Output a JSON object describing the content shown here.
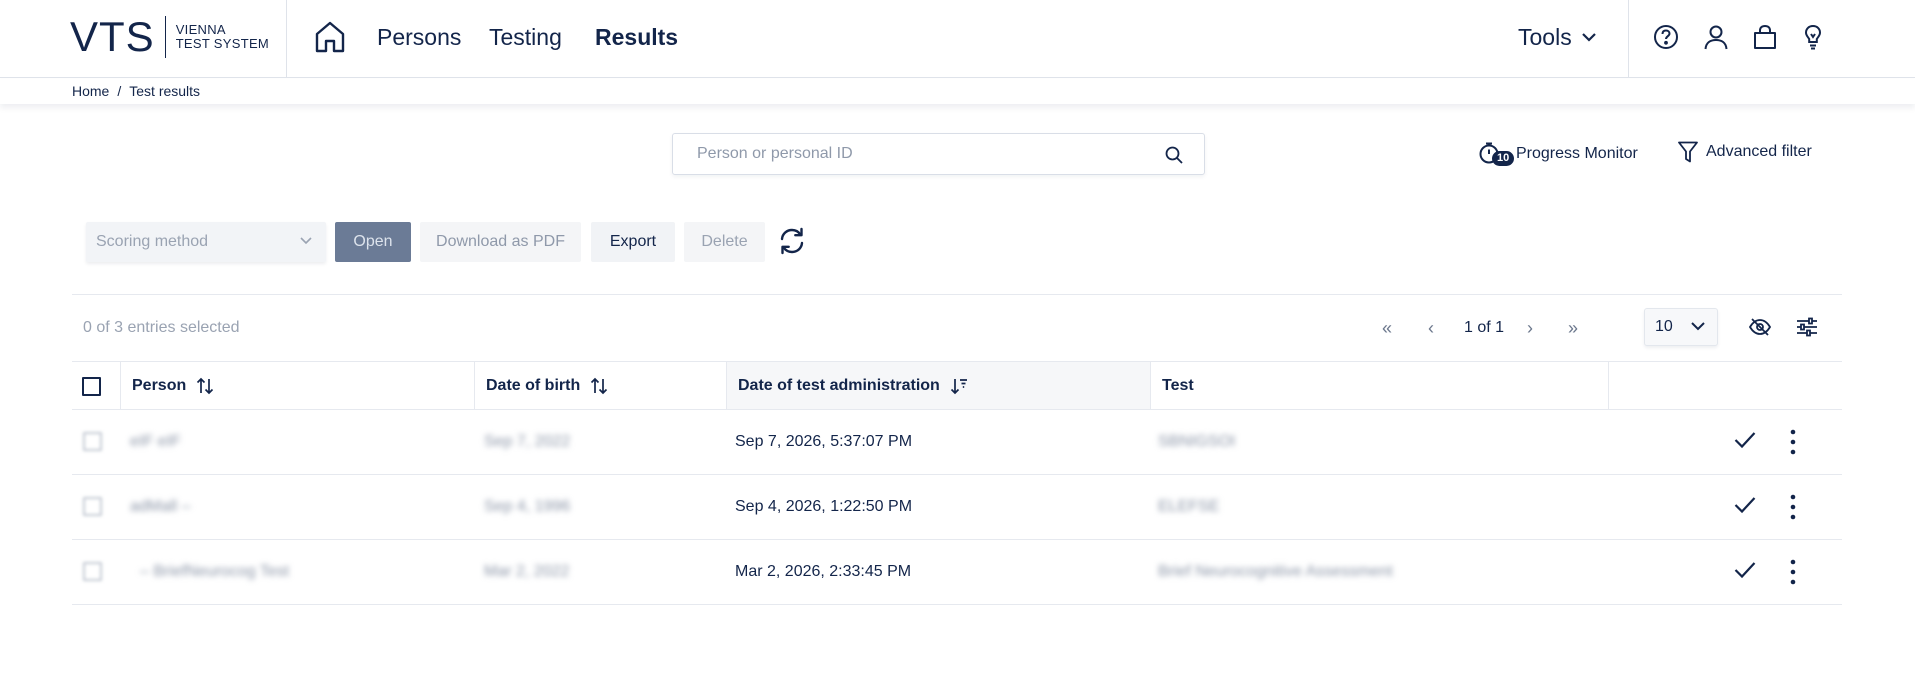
{
  "header": {
    "logo_mark": "VTS",
    "logo_line1": "VIENNA",
    "logo_line2": "TEST SYSTEM",
    "nav": [
      {
        "label": "Persons",
        "active": false
      },
      {
        "label": "Testing",
        "active": false
      },
      {
        "label": "Results",
        "active": true
      }
    ],
    "tools_label": "Tools",
    "icons": [
      "home-icon",
      "help-icon",
      "user-icon",
      "shopping-bag-icon",
      "lightbulb-icon"
    ]
  },
  "breadcrumb": {
    "home": "Home",
    "separator": "/",
    "current": "Test results"
  },
  "search": {
    "placeholder": "Person or personal ID",
    "value": ""
  },
  "progress_monitor": {
    "badge": "10",
    "label": "Progress Monitor"
  },
  "advanced_filter": {
    "label": "Advanced filter"
  },
  "toolbar": {
    "scoring_placeholder": "Scoring method",
    "open_label": "Open",
    "pdf_label": "Download as PDF",
    "export_label": "Export",
    "delete_label": "Delete"
  },
  "table_controls": {
    "selected_text": "0 of 3 entries selected",
    "page_text": "1 of 1",
    "page_size": "10",
    "first": "«",
    "prev": "‹",
    "next": "›",
    "last": "»"
  },
  "table": {
    "columns": {
      "person": "Person",
      "dob": "Date of birth",
      "date_admin": "Date of test administration",
      "test": "Test"
    },
    "rows": [
      {
        "person": "eIF eIF",
        "dob": "Sep 7, 2022",
        "date_admin": "Sep 7, 2026, 5:37:07 PM",
        "test": "SBNIGSOI"
      },
      {
        "person": "adMall –",
        "dob": "Sep 4, 1996",
        "date_admin": "Sep 4, 2026, 1:22:50 PM",
        "test": "ELEFSE"
      },
      {
        "person": "–  BriefNeurocog Test",
        "dob": "Mar 2, 2022",
        "date_admin": "Mar 2, 2026, 2:33:45 PM",
        "test": "Brief Neurocognitive Assessment"
      }
    ]
  },
  "colors": {
    "primary": "#13254a",
    "muted": "#9aa3b2",
    "open_button": "#6b7b96",
    "border": "#e6e9ef"
  }
}
